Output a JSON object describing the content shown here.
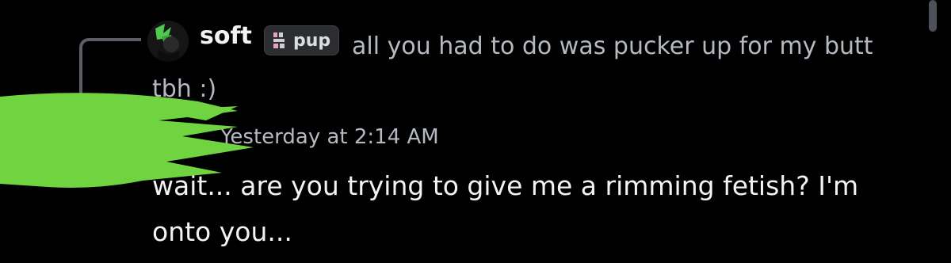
{
  "reply": {
    "author": "soft",
    "role_tag": "pup",
    "text": "all you had to do was pucker up for my butt tbh :)"
  },
  "message": {
    "timestamp": "Yesterday at 2:14 AM",
    "text": "wait... are you trying to give me a rimming fetish? I'm onto you..."
  },
  "colors": {
    "background": "#000000",
    "redaction": "#6fd43f",
    "avatar_accent": "#4ecb4e",
    "role_icon": "#e8a0c8"
  },
  "icons": {
    "reply_avatar": "avatar-icon",
    "role_tag_icon": "role-tag-icon"
  }
}
